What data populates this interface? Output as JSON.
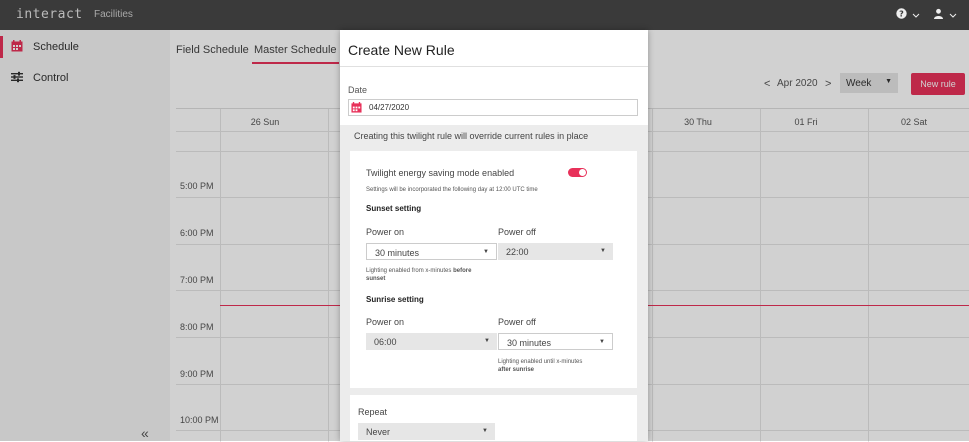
{
  "topbar": {
    "logo": "interact",
    "nav_item": "Facilities",
    "help_icon": "?",
    "user_icon": "user"
  },
  "sidebar": {
    "items": [
      {
        "label": "Schedule",
        "icon": "calendar-icon"
      },
      {
        "label": "Control",
        "icon": "sliders-icon"
      }
    ],
    "collapse": "«"
  },
  "main": {
    "tabs": [
      {
        "label": "Field Schedule"
      },
      {
        "label": "Master Schedule"
      }
    ],
    "nav": {
      "prev": "<",
      "month": "Apr 2020",
      "next": ">"
    },
    "view_select": "Week",
    "new_rule": "New rule",
    "days": [
      "26 Sun",
      "30 Thu",
      "01 Fri",
      "02 Sat"
    ],
    "times": [
      "5:00 PM",
      "6:00 PM",
      "7:00 PM",
      "8:00 PM",
      "9:00 PM",
      "10:00 PM"
    ]
  },
  "modal": {
    "title": "Create New Rule",
    "date_label": "Date",
    "date_value": "04/27/2020",
    "notice": "Creating this twilight rule will override current rules in place",
    "twilight_label": "Twilight energy saving mode enabled",
    "twilight_note": "Settings will be incorporated the following day at 12:00 UTC time",
    "sunset": {
      "title": "Sunset setting",
      "power_on_label": "Power on",
      "power_on_value": "30 minutes",
      "power_off_label": "Power off",
      "power_off_value": "22:00",
      "note": "Lighting enabled from x-minutes",
      "note_bold_1": "before",
      "note_bold_2": "sunset"
    },
    "sunrise": {
      "title": "Sunrise setting",
      "power_on_label": "Power on",
      "power_on_value": "06:00",
      "power_off_label": "Power off",
      "power_off_value": "30 minutes",
      "note": "Lighting enabled until x-minutes",
      "note_bold": "after sunrise"
    },
    "repeat_label": "Repeat",
    "repeat_value": "Never"
  },
  "colors": {
    "accent": "#e8315a",
    "topbar": "#3a3a3a"
  }
}
